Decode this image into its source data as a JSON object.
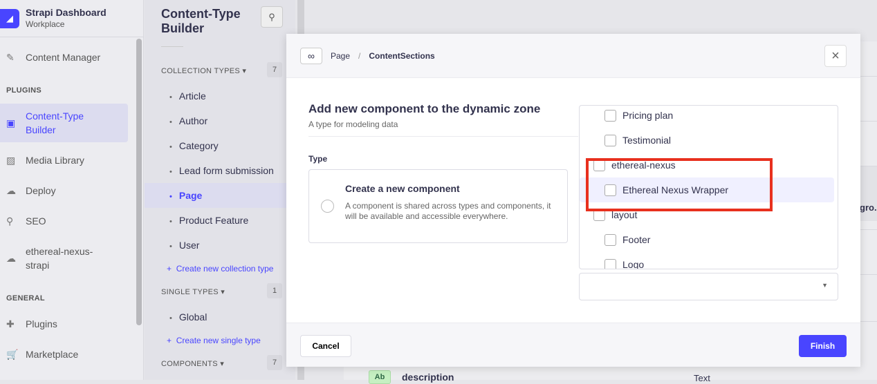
{
  "brand": {
    "title": "Strapi Dashboard",
    "subtitle": "Workplace"
  },
  "nav": {
    "content_manager": "Content Manager",
    "plugins_label": "PLUGINS",
    "items": [
      "Content-Type Builder",
      "Media Library",
      "Deploy",
      "SEO",
      "ethereal-nexus-strapi"
    ],
    "general_label": "GENERAL",
    "general": [
      "Plugins",
      "Marketplace"
    ]
  },
  "ctb": {
    "title": "Content-Type Builder",
    "collection_label": "COLLECTION TYPES",
    "collection_count": "7",
    "collection_items": [
      "Article",
      "Author",
      "Category",
      "Lead form submission",
      "Page",
      "Product Feature",
      "User"
    ],
    "create_collection": "Create new collection type",
    "single_label": "SINGLE TYPES",
    "single_count": "1",
    "single_items": [
      "Global"
    ],
    "create_single": "Create new single type",
    "components_label": "COMPONENTS",
    "components_count": "7"
  },
  "background": {
    "truncated": "gro...",
    "field_name": "description",
    "field_type": "Text",
    "field_badge": "Ab"
  },
  "modal": {
    "breadcrumb": [
      "Page",
      "ContentSections"
    ],
    "title": "Add new component to the dynamic zone",
    "subtitle": "A type for modeling data",
    "type_label": "Type",
    "card_title": "Create a new component",
    "card_desc": "A component is shared across types and components, it will be available and accessible everywhere.",
    "options": [
      "Pricing plan",
      "Testimonial",
      "ethereal-nexus",
      "Ethereal Nexus Wrapper",
      "layout",
      "Footer",
      "Logo"
    ],
    "cancel": "Cancel",
    "finish": "Finish"
  },
  "colors": {
    "accent": "#4945ff",
    "highlight": "#e8301e"
  }
}
